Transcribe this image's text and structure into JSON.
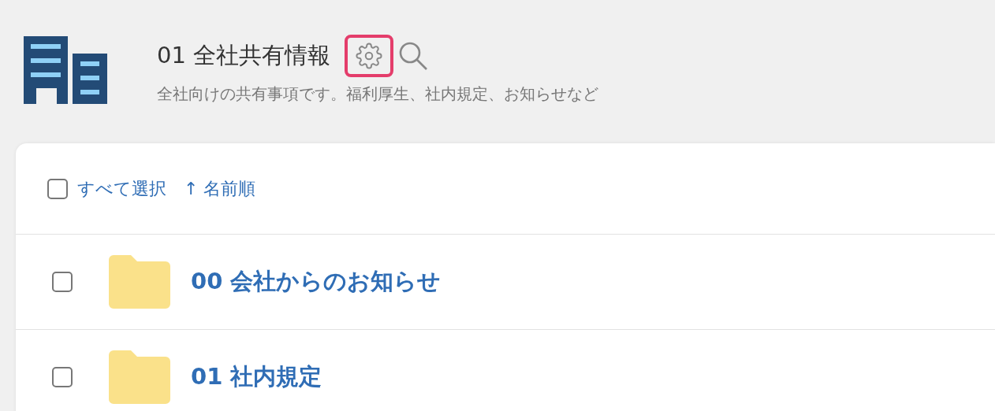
{
  "header": {
    "title": "01 全社共有情報",
    "description": "全社向けの共有事項です。福利厚生、社内規定、お知らせなど",
    "settings_button": {
      "highlighted": true
    }
  },
  "toolbar": {
    "select_all": {
      "label": "すべて選択",
      "checked": false
    },
    "sort": {
      "label": "↑ 名前順"
    }
  },
  "items": [
    {
      "name": "00 会社からのお知らせ",
      "checked": false
    },
    {
      "name": "01 社内規定",
      "checked": false
    }
  ]
}
